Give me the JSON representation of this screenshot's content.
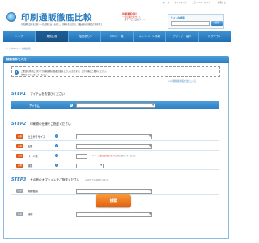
{
  "top_links": [
    "ホーム",
    "サイトマップ",
    "プライバシーポリシー",
    "お問合せ"
  ],
  "header": {
    "logo_title": "印刷通販徹底比較",
    "logo_subtitle": "印刷通販会社を比較・一括見積で安くお得に。印刷料金を比較して最安値の印刷会社を探そう",
    "promo_line1": "印刷通販会社",
    "promo_line2": "一括見積比較サイト",
    "promo_line3": "一括サービス比較サイト",
    "search_title": "サイト内検索",
    "search_placeholder": "",
    "search_button": "検索"
  },
  "nav": [
    {
      "label": "トップ",
      "active": false
    },
    {
      "label": "見積比較",
      "active": true
    },
    {
      "label": "一括見積もり",
      "active": false
    },
    {
      "label": "口コミ一覧",
      "active": false
    },
    {
      "label": "キャンペーン情報",
      "active": false
    },
    {
      "label": "デザイナー紹介",
      "active": false
    },
    {
      "label": "ログアウト",
      "active": false
    }
  ],
  "breadcrumb": "トップページ > 価格比較",
  "section_title": "検索条件を入力",
  "notice": {
    "icon": "!",
    "line1": "ご希望の条件に合わせて印刷通販の価格比較をしていただけます。上から順にご選択ください。",
    "line2": "条件を全て入力してください。",
    "link": ">>印刷価格比較方法はこちら"
  },
  "step1": {
    "no": "STEP1",
    "text": "アイテムをお選びください",
    "item_label": "アイテム"
  },
  "step2": {
    "no": "STEP2",
    "text": "印刷物の仕様をご指定ください",
    "rows": [
      {
        "badge": "必須",
        "label": "仕上がりサイズ"
      },
      {
        "badge": "必須",
        "label": "色数"
      },
      {
        "badge": "必須",
        "label": "ページ数"
      },
      {
        "badge": "必須",
        "label": "部数"
      }
    ],
    "page_note_prefix": "※ページ数は表紙を含めた数",
    "page_note_suffix": "を選択してください"
  },
  "step3": {
    "no": "STEP3",
    "text": "その他のオプションをご指定ください",
    "text_note": "（未指定でも検索できます）",
    "rows": [
      {
        "badge": "任意",
        "label": "用紙種類"
      },
      {
        "badge": "任意",
        "label": "納期"
      }
    ]
  },
  "cta_label": "検索",
  "colors": {
    "brand_blue": "#2d7fc0",
    "cta_orange": "#e15f0c",
    "required": "#e25b16"
  }
}
